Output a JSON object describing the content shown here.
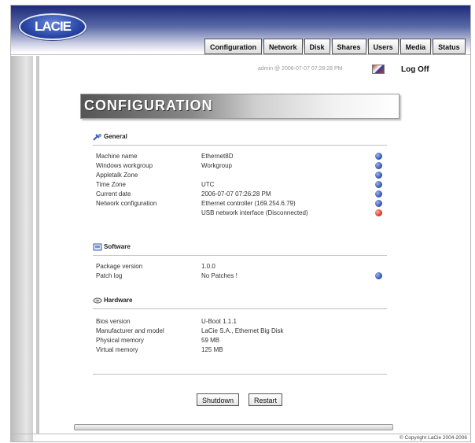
{
  "brand": {
    "logo_text": "LACIE"
  },
  "tabs": [
    "Configuration",
    "Network",
    "Disk",
    "Shares",
    "Users",
    "Media",
    "Status"
  ],
  "session": {
    "user": "admin @ 2006-07-07 07:28:28 PM",
    "logoff": "Log Off"
  },
  "page_title": "CONFIGURATION",
  "general": {
    "title": "General",
    "rows": [
      {
        "label": "Machine name",
        "value": "Ethernet8D",
        "status": "blue"
      },
      {
        "label": "Windows workgroup",
        "value": "Workgroup",
        "status": "blue"
      },
      {
        "label": "Appletalk Zone",
        "value": "",
        "status": "blue"
      },
      {
        "label": "Time Zone",
        "value": "UTC",
        "status": "blue"
      },
      {
        "label": "Current date",
        "value": "2006-07-07 07:26:28 PM",
        "status": "blue"
      },
      {
        "label": "Network configuration",
        "value": "Ethernet controller (169.254.6.79)",
        "status": "blue"
      },
      {
        "label": "",
        "value": "USB network interface (Disconnected)",
        "status": "red"
      }
    ]
  },
  "software": {
    "title": "Software",
    "rows": [
      {
        "label": "Package version",
        "value": "1.0.0",
        "status": ""
      },
      {
        "label": "Patch log",
        "value": "No Patches !",
        "status": "blue"
      }
    ]
  },
  "hardware": {
    "title": "Hardware",
    "rows": [
      {
        "label": "Bios version",
        "value": "U-Boot 1.1.1",
        "status": ""
      },
      {
        "label": "Manufacturer and model",
        "value": "LaCie S.A., Ethernet Big Disk",
        "status": ""
      },
      {
        "label": "Physical memory",
        "value": "59 MB",
        "status": ""
      },
      {
        "label": "Virtual memory",
        "value": "125 MB",
        "status": ""
      }
    ]
  },
  "buttons": {
    "shutdown": "Shutdown",
    "restart": "Restart"
  },
  "footer": {
    "copyright": "© Copyright LaCie 2004-2006"
  },
  "colors": {
    "header_dark": "#1d2a7a",
    "status_blue": "#3a5bb7",
    "status_red": "#e23a2a"
  }
}
